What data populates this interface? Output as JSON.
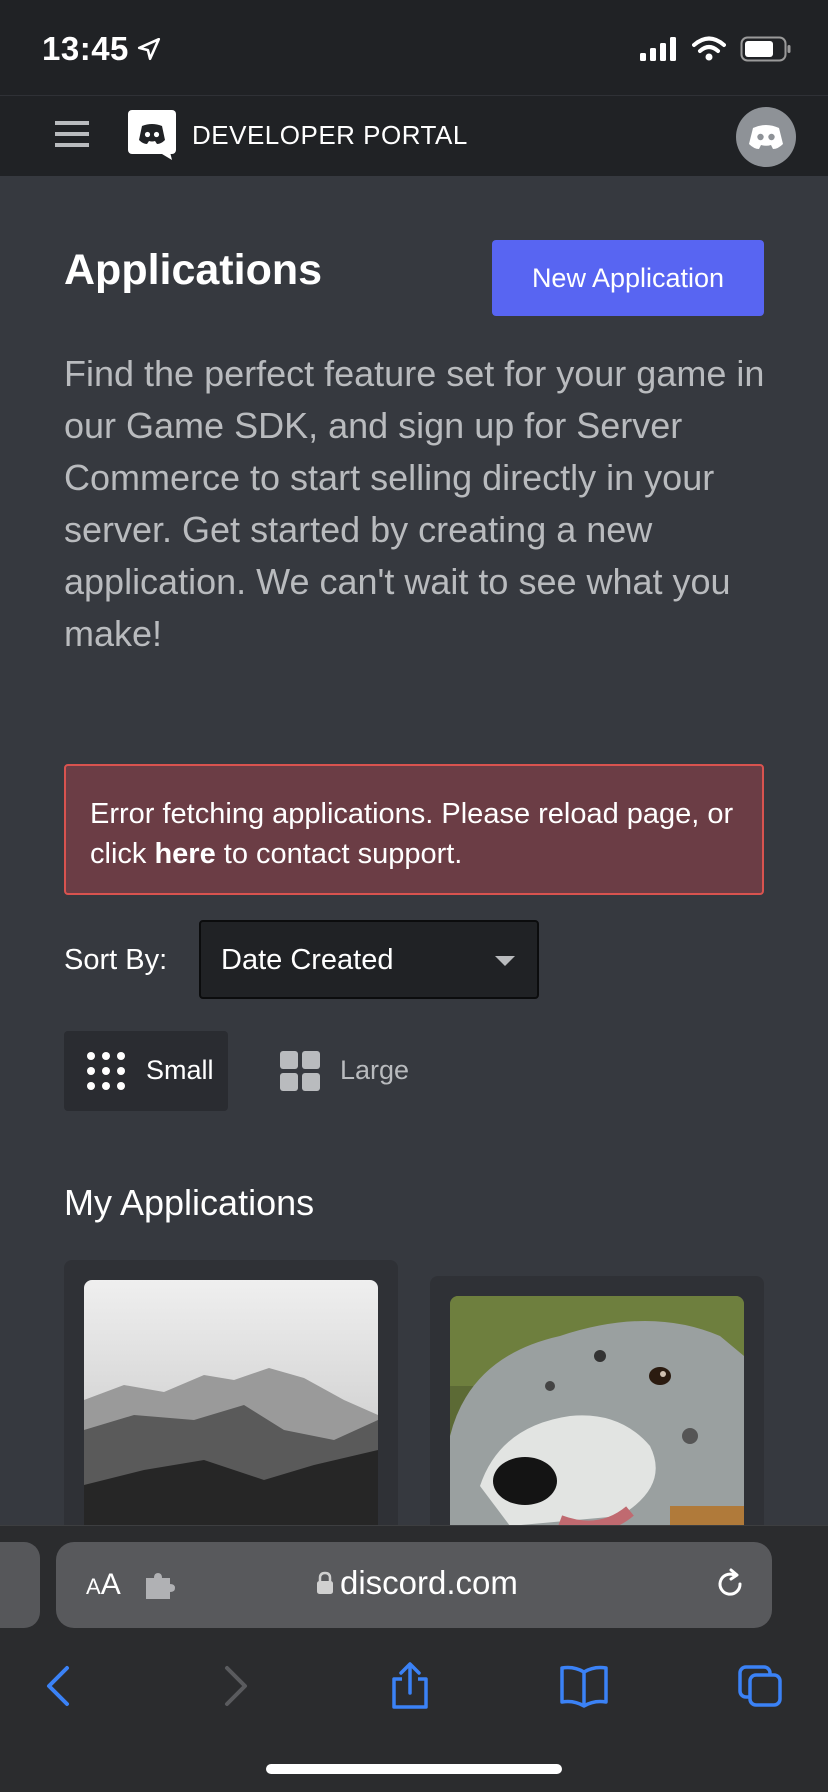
{
  "status_bar": {
    "time": "13:45"
  },
  "nav": {
    "title": "DEVELOPER PORTAL"
  },
  "main": {
    "title": "Applications",
    "new_app_label": "New Application",
    "intro": "Find the perfect feature set for your game in our Game SDK, and sign up for Server Commerce to start selling directly in your server. Get started by creating a new application. We can't wait to see what you make!",
    "error": {
      "prefix": "Error fetching applications. Please reload page, or click ",
      "link": "here",
      "suffix": " to contact support."
    },
    "sort": {
      "label": "Sort By:",
      "value": "Date Created"
    },
    "view": {
      "small_label": "Small",
      "large_label": "Large",
      "selected": "Small"
    },
    "section_title": "My Applications"
  },
  "browser": {
    "text_size_small": "A",
    "text_size_large": "A",
    "url": "discord.com"
  },
  "colors": {
    "accent": "#5865f2",
    "background": "#36393f",
    "nav": "#202225",
    "error_bg": "#6b3d45",
    "error_border": "#d9534f",
    "safari_blue": "#3b82f6"
  }
}
